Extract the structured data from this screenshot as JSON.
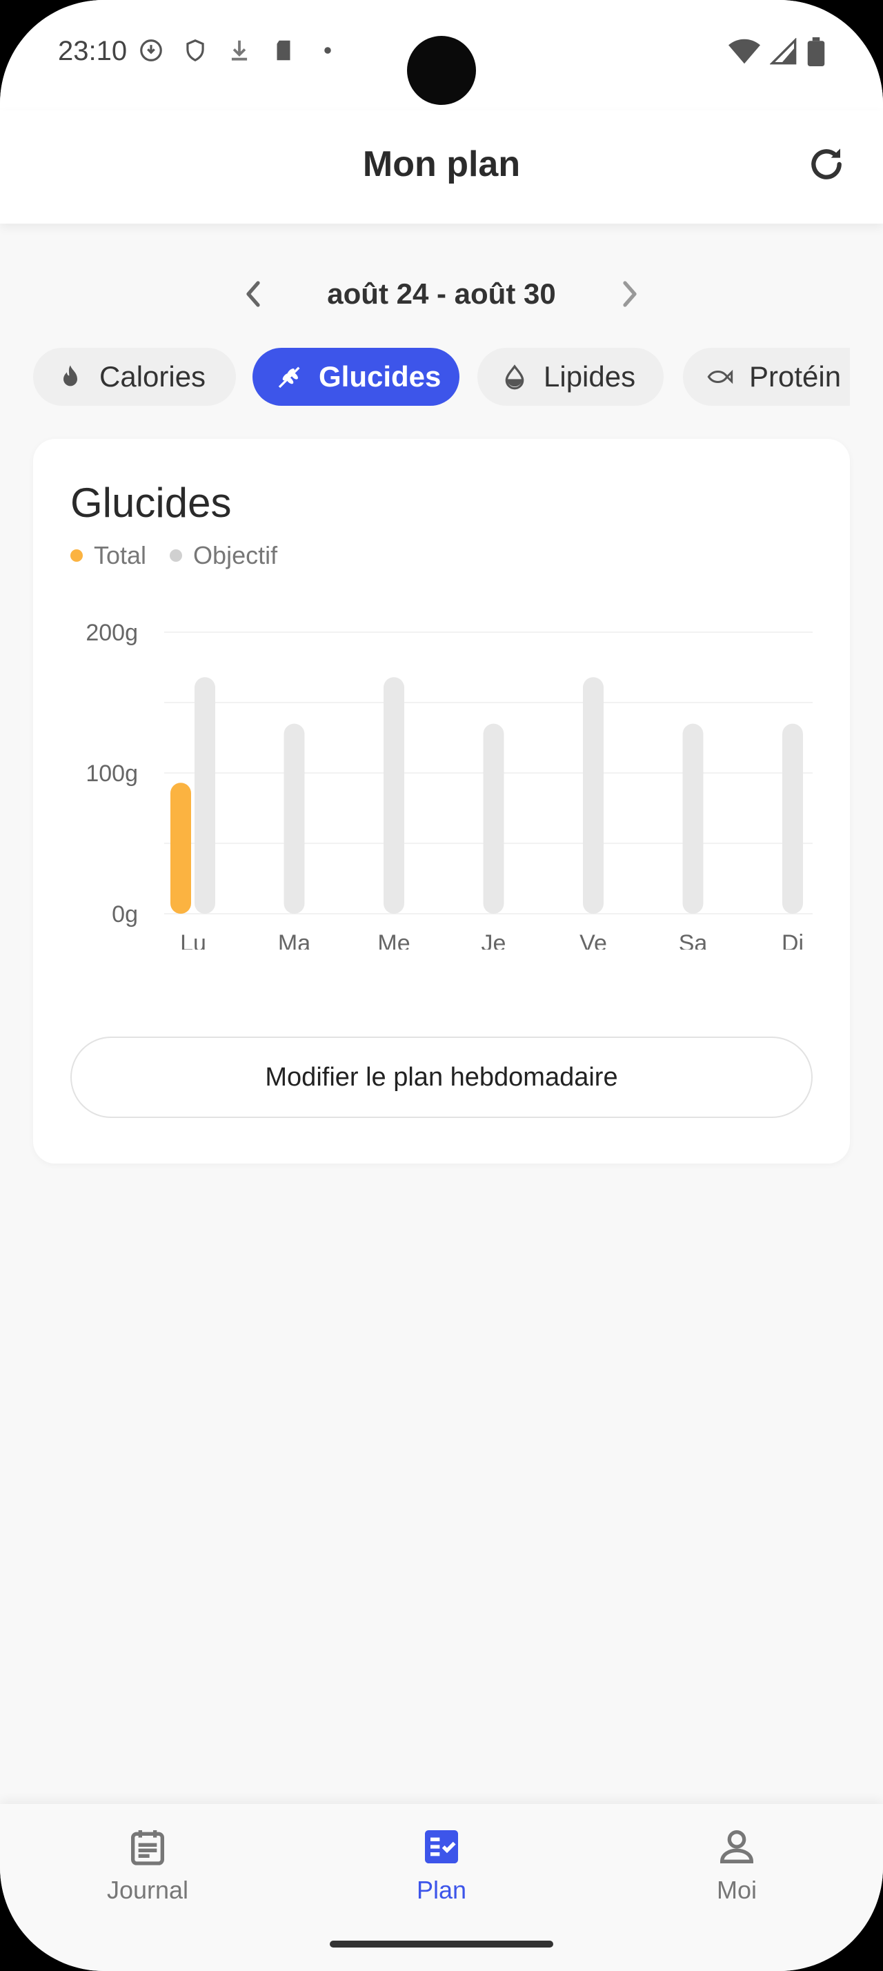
{
  "status_bar": {
    "time": "23:10"
  },
  "header": {
    "title": "Mon plan"
  },
  "week": {
    "label": "août 24 - août 30"
  },
  "chips": [
    {
      "label": "Calories",
      "icon": "flame-icon",
      "active": false
    },
    {
      "label": "Glucides",
      "icon": "grain-icon",
      "active": true
    },
    {
      "label": "Lipides",
      "icon": "drop-icon",
      "active": false
    },
    {
      "label": "Protéin",
      "icon": "fish-icon",
      "active": false
    }
  ],
  "card": {
    "title": "Glucides",
    "legend": {
      "total_label": "Total",
      "goal_label": "Objectif"
    },
    "edit_button": "Modifier le plan hebdomadaire"
  },
  "colors": {
    "accent": "#3d55ea",
    "total": "#fbb341",
    "goal": "#e8e8e8"
  },
  "chart_data": {
    "type": "bar",
    "categories": [
      "Lu",
      "Ma",
      "Me",
      "Je",
      "Ve",
      "Sa",
      "Di"
    ],
    "series": [
      {
        "name": "Total",
        "values": [
          93,
          0,
          0,
          0,
          0,
          0,
          0
        ]
      },
      {
        "name": "Objectif",
        "values": [
          168,
          135,
          168,
          135,
          168,
          135,
          135
        ]
      }
    ],
    "ylim": [
      0,
      200
    ],
    "yticks": [
      "0g",
      "100g",
      "200g"
    ],
    "title": "Glucides",
    "xlabel": "",
    "ylabel": ""
  },
  "nav": {
    "items": [
      {
        "label": "Journal",
        "icon": "journal-icon",
        "active": false
      },
      {
        "label": "Plan",
        "icon": "plan-icon",
        "active": true
      },
      {
        "label": "Moi",
        "icon": "person-icon",
        "active": false
      }
    ]
  }
}
